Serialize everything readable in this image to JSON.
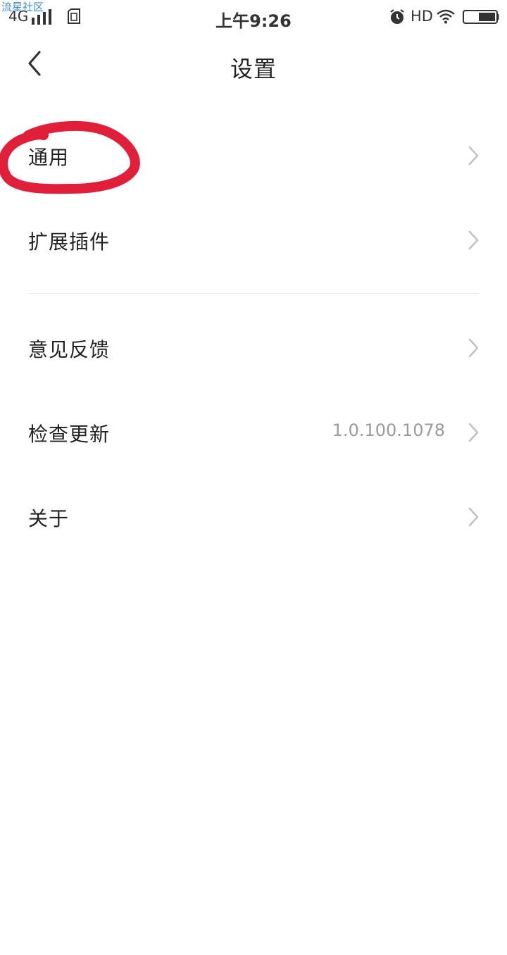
{
  "watermark": "流星社区",
  "status_bar": {
    "network": "4G",
    "time": "上午9:26",
    "hd": "HD",
    "icons": [
      "signal-icon",
      "sim-icon",
      "alarm-icon",
      "wifi-icon",
      "battery-icon"
    ]
  },
  "header": {
    "title": "设置",
    "back_icon": "chevron-left-icon"
  },
  "settings": {
    "items": [
      {
        "label": "通用",
        "value": ""
      },
      {
        "label": "扩展插件",
        "value": ""
      },
      {
        "label": "意见反馈",
        "value": ""
      },
      {
        "label": "检查更新",
        "value": "1.0.100.1078"
      },
      {
        "label": "关于",
        "value": ""
      }
    ]
  },
  "annotation": {
    "color": "#e0203a",
    "target": "通用"
  }
}
